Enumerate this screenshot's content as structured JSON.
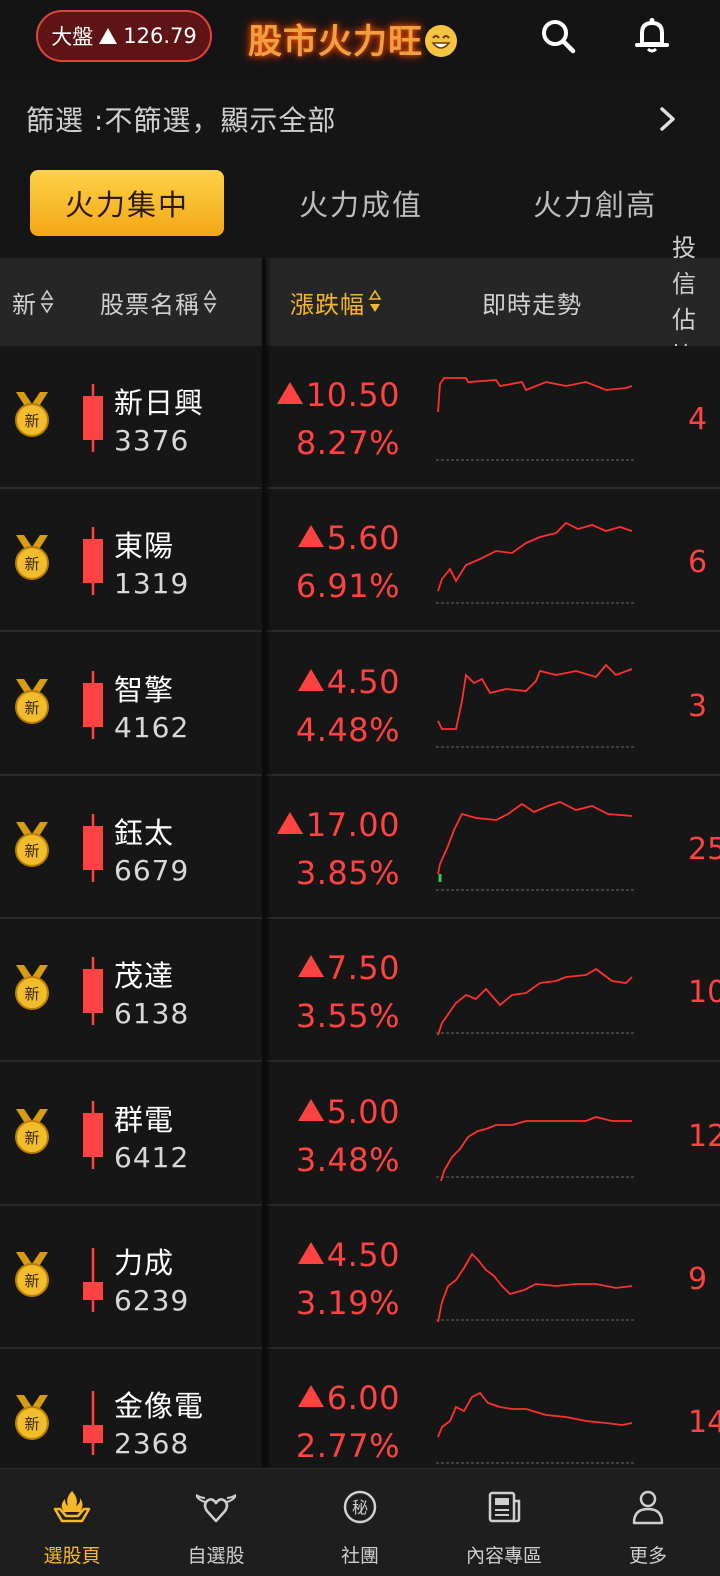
{
  "header": {
    "index_label": "大盤",
    "index_value": "126.79",
    "logo_text": "股市火力旺",
    "search_icon": "search-icon",
    "bell_icon": "bell-icon"
  },
  "filter": {
    "text": "篩選 :不篩選，顯示全部"
  },
  "tabs": [
    {
      "label": "火力集中",
      "active": true
    },
    {
      "label": "火力成值",
      "active": false
    },
    {
      "label": "火力創高",
      "active": false
    }
  ],
  "table_header": {
    "new": "新",
    "name": "股票名稱",
    "change": "漲跌幅",
    "trend": "即時走勢",
    "trust_line1": "投信",
    "trust_line2": "佔比"
  },
  "colors": {
    "up": "#ff4242",
    "accent": "#f6b82a",
    "down": "#35c759"
  },
  "rows": [
    {
      "name": "新日興",
      "code": "3376",
      "change": "10.50",
      "pct": "8.27%",
      "tail": "4",
      "candle": "full"
    },
    {
      "name": "東陽",
      "code": "1319",
      "change": "5.60",
      "pct": "6.91%",
      "tail": "6",
      "candle": "full"
    },
    {
      "name": "智擎",
      "code": "4162",
      "change": "4.50",
      "pct": "4.48%",
      "tail": "3",
      "candle": "full"
    },
    {
      "name": "鈺太",
      "code": "6679",
      "change": "17.00",
      "pct": "3.85%",
      "tail": "25",
      "candle": "full"
    },
    {
      "name": "茂達",
      "code": "6138",
      "change": "7.50",
      "pct": "3.55%",
      "tail": "10",
      "candle": "full"
    },
    {
      "name": "群電",
      "code": "6412",
      "change": "5.00",
      "pct": "3.48%",
      "tail": "12",
      "candle": "full"
    },
    {
      "name": "力成",
      "code": "6239",
      "change": "4.50",
      "pct": "3.19%",
      "tail": "9",
      "candle": "low"
    },
    {
      "name": "金像電",
      "code": "2368",
      "change": "6.00",
      "pct": "2.77%",
      "tail": "14",
      "candle": "low"
    }
  ],
  "nav": [
    {
      "label": "選股頁",
      "icon": "fire-hands-icon",
      "active": true
    },
    {
      "label": "自選股",
      "icon": "winged-heart-icon",
      "active": false
    },
    {
      "label": "社團",
      "icon": "secret-badge-icon",
      "active": false
    },
    {
      "label": "內容專區",
      "icon": "newspaper-icon",
      "active": false
    },
    {
      "label": "更多",
      "icon": "user-icon",
      "active": false
    }
  ]
}
